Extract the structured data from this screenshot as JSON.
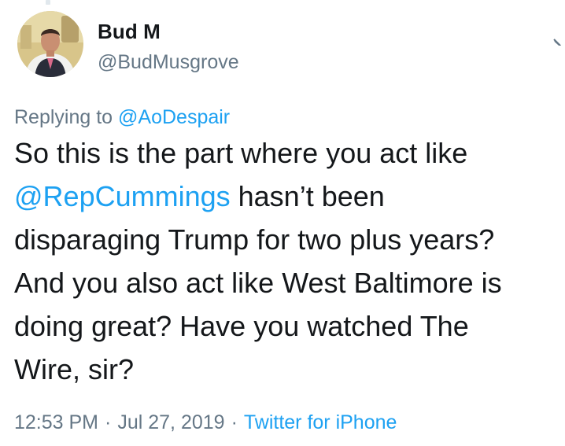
{
  "author": {
    "display_name": "Bud M",
    "handle": "@BudMusgrove"
  },
  "reply": {
    "prefix": "Replying to",
    "to_handle": "@AoDespair"
  },
  "tweet": {
    "line1": "So this is the part where you act like",
    "line2_mention": "@RepCummings",
    "line2_rest": " hasn’t been",
    "line3": "disparaging Trump for two plus years?",
    "line4": "And you also act like West Baltimore is",
    "line5": "doing great? Have you watched The",
    "line6": "Wire, sir?"
  },
  "meta": {
    "time": "12:53 PM",
    "separator": "·",
    "date": "Jul 27, 2019",
    "source": "Twitter for iPhone"
  },
  "icons": {
    "avatar": "profile-photo",
    "menu": "chevron-down-icon"
  },
  "colors": {
    "text": "#14171a",
    "secondary": "#657786",
    "link": "#1da1f2"
  }
}
